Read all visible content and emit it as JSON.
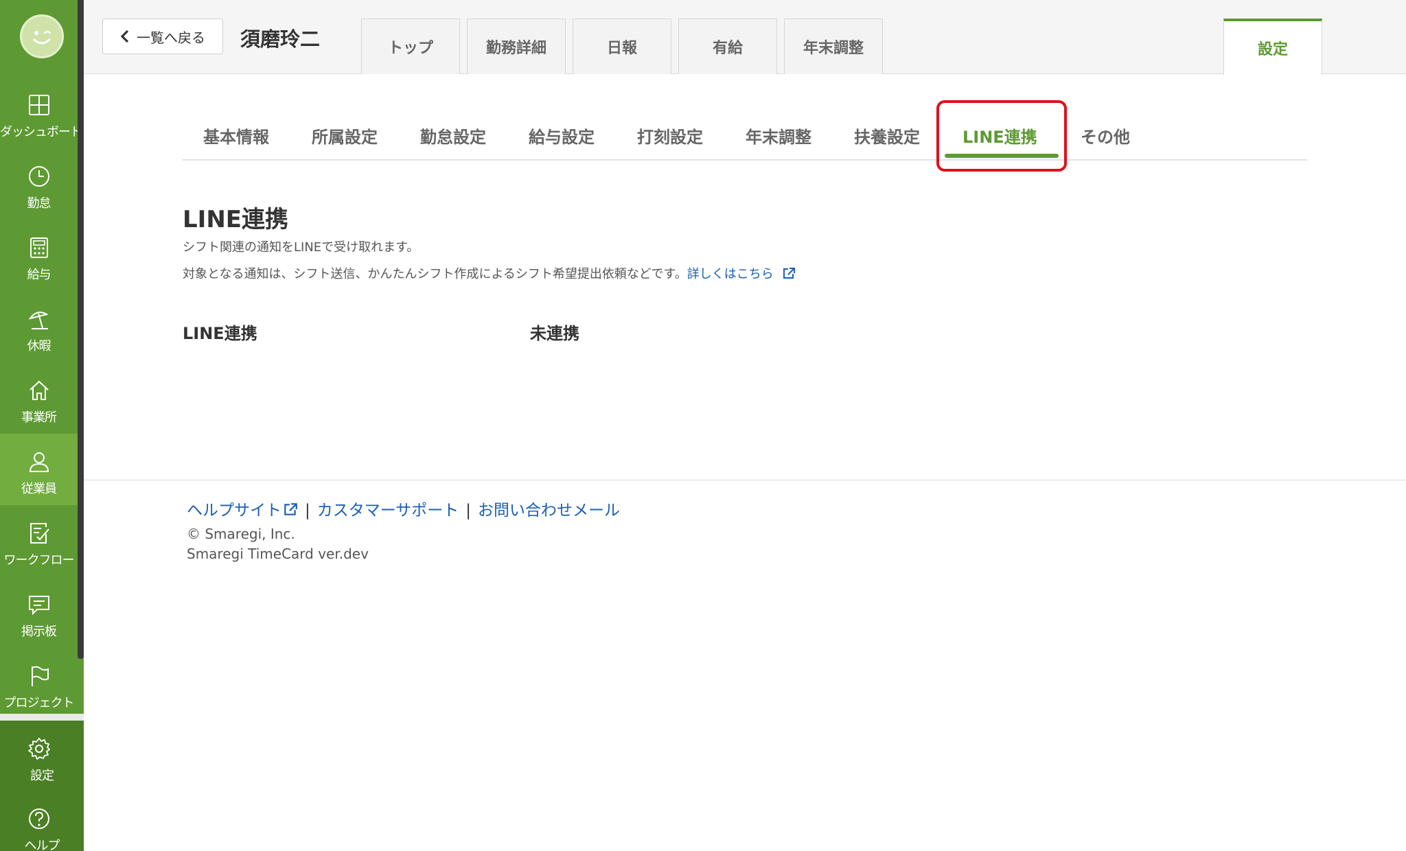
{
  "sidebar": {
    "items": [
      {
        "label": "ダッシュボード",
        "icon": "dashboard-icon"
      },
      {
        "label": "勤怠",
        "icon": "clock-icon"
      },
      {
        "label": "給与",
        "icon": "calculator-icon"
      },
      {
        "label": "休暇",
        "icon": "beach-umbrella-icon"
      },
      {
        "label": "事業所",
        "icon": "home-icon"
      },
      {
        "label": "従業員",
        "icon": "user-icon"
      },
      {
        "label": "ワークフロー",
        "icon": "checklist-icon"
      },
      {
        "label": "掲示板",
        "icon": "message-icon"
      },
      {
        "label": "プロジェクト",
        "icon": "flag-icon"
      }
    ],
    "settings_label": "設定",
    "help_label": "ヘルプ"
  },
  "header": {
    "back_label": "一覧へ戻る",
    "employee_name": "須磨玲二",
    "tabs": [
      "トップ",
      "勤務詳細",
      "日報",
      "有給",
      "年末調整"
    ],
    "settings_tab": "設定"
  },
  "subtabs": [
    "基本情報",
    "所属設定",
    "勤怠設定",
    "給与設定",
    "打刻設定",
    "年末調整",
    "扶養設定",
    "LINE連携",
    "その他"
  ],
  "content": {
    "title": "LINE連携",
    "desc1": "シフト関連の通知をLINEで受け取れます。",
    "desc2": "対象となる通知は、シフト送信、かんたんシフト作成によるシフト希望提出依頼などです。",
    "detail_link": "詳しくはこちら",
    "row_label": "LINE連携",
    "row_value": "未連携"
  },
  "footer": {
    "help_site": "ヘルプサイト",
    "support": "カスタマーサポート",
    "contact": "お問い合わせメール",
    "copyright": "© Smaregi, Inc.",
    "version": "Smaregi TimeCard ver.dev"
  },
  "colors": {
    "brand_green": "#5e9a33",
    "sidebar_active": "#72ad40",
    "link_blue": "#1a5fb4",
    "highlight_red": "#e0101a"
  }
}
